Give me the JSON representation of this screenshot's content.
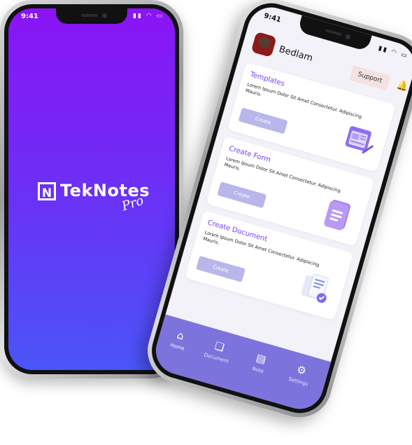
{
  "splash": {
    "status_time": "9:41",
    "logo_mark": "N",
    "logo_text": "TekNotes",
    "logo_sub": "Pro"
  },
  "home": {
    "status_time": "9:41",
    "user": {
      "name": "Bedlam"
    },
    "support_label": "Support",
    "cards": [
      {
        "title": "Templates",
        "description": "Lorem Ipsum Dolor Sit Amet Consectetur. Adipiscing Mauris.",
        "button": "Create",
        "icon": "template-icon"
      },
      {
        "title": "Create Form",
        "description": "Lorem Ipsum Dolor Sit Amet Consectetur. Adipiscing Mauris.",
        "button": "Create",
        "icon": "form-icon"
      },
      {
        "title": "Create Document",
        "description": "Lorem Ipsum Dolor Sit Amet Consectetur. Adipiscing Mauris.",
        "button": "Create",
        "icon": "document-icon"
      }
    ],
    "tabs": [
      {
        "label": "Home",
        "icon": "home-icon"
      },
      {
        "label": "Document",
        "icon": "document-icon"
      },
      {
        "label": "Note",
        "icon": "note-icon"
      },
      {
        "label": "Settings",
        "icon": "settings-icon"
      }
    ]
  },
  "colors": {
    "splash_top": "#8a14f5",
    "splash_bottom": "#4a55f8",
    "accent": "#7a3cf2",
    "tabbar": "#7d73dc",
    "button": "#b8b6ea"
  }
}
